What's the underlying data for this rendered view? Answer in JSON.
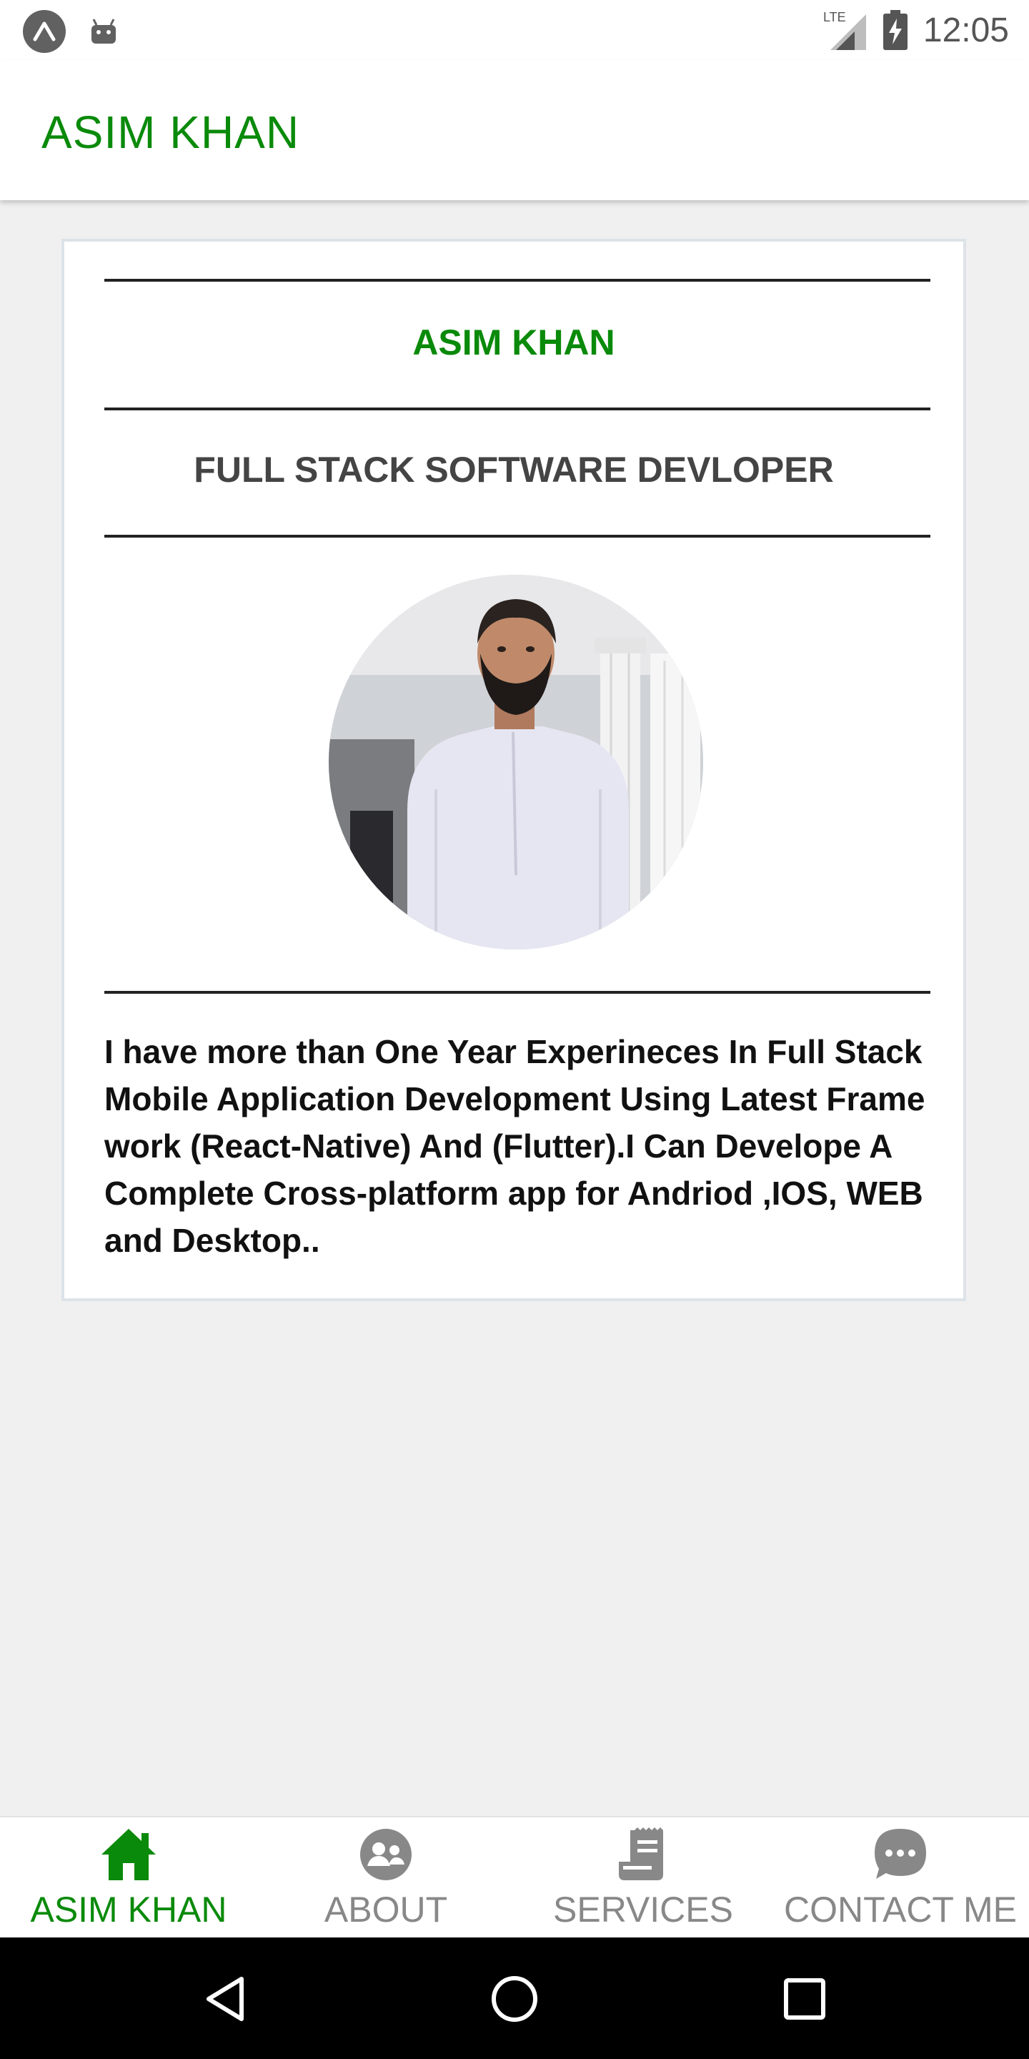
{
  "status_bar": {
    "time": "12:05",
    "network": "LTE",
    "icons": [
      "expo-icon",
      "android-debug-icon",
      "lte-signal-icon",
      "battery-charging-icon"
    ]
  },
  "header": {
    "title": "ASIM KHAN"
  },
  "profile": {
    "name": "ASIM KHAN",
    "role": "FULL STACK  SOFTWARE DEVLOPER",
    "photo": "profile-photo",
    "bio": "I have more than One Year Experineces In Full Stack Mobile Application Development Using Latest Frame work (React-Native) And (Flutter).I Can Develope  A Complete Cross-platform app for Andriod ,IOS, WEB and Desktop.."
  },
  "tabs": [
    {
      "label": "ASIM KHAN",
      "icon": "home-icon",
      "active": true
    },
    {
      "label": "ABOUT",
      "icon": "people-icon",
      "active": false
    },
    {
      "label": "SERVICES",
      "icon": "receipt-icon",
      "active": false
    },
    {
      "label": "CONTACT ME",
      "icon": "chat-icon",
      "active": false
    }
  ],
  "colors": {
    "accent": "#0a8a0a",
    "inactive": "#888888",
    "background": "#f0f0f0"
  },
  "nav_bar": {
    "icons": [
      "back-icon",
      "home-circle-icon",
      "recents-icon"
    ]
  }
}
